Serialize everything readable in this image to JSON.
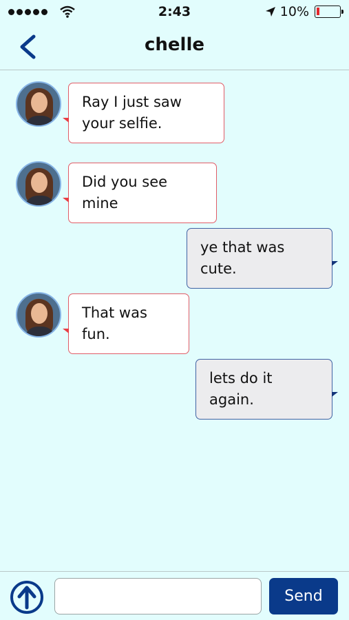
{
  "status_bar": {
    "time": "2:43",
    "battery_percent": "10%",
    "icons": [
      "signal-dots-icon",
      "wifi-icon",
      "location-arrow-icon",
      "battery-icon"
    ]
  },
  "nav": {
    "title": "chelle",
    "back_icon": "chevron-left-icon"
  },
  "messages": [
    {
      "direction": "in",
      "text": "Ray I just saw your selfie."
    },
    {
      "direction": "in",
      "text": "Did you see mine"
    },
    {
      "direction": "out",
      "text": "ye that was cute."
    },
    {
      "direction": "in",
      "text": "That was fun."
    },
    {
      "direction": "out",
      "text": "lets do it again."
    }
  ],
  "composer": {
    "input_value": "",
    "upload_icon": "upload-arrow-icon",
    "send_label": "Send"
  },
  "colors": {
    "background": "#e2fdfd",
    "accent": "#0a3a8a",
    "incoming_border": "#e05b66",
    "outgoing_border": "#4061a2",
    "outgoing_fill": "#ececee"
  }
}
